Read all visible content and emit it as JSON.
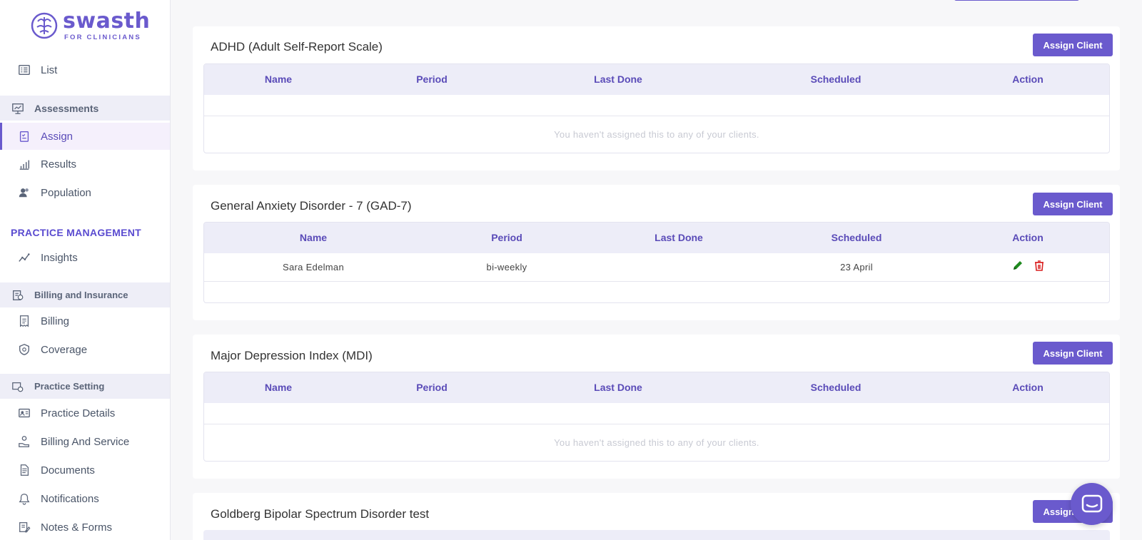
{
  "brand": {
    "name": "swasth",
    "tagline": "FOR CLINICIANS"
  },
  "sidebar": {
    "list": "List",
    "assessments": "Assessments",
    "assign": "Assign",
    "results": "Results",
    "population": "Population",
    "practice_management": "PRACTICE MANAGEMENT",
    "insights": "Insights",
    "billing_insurance": "Billing and Insurance",
    "billing": "Billing",
    "coverage": "Coverage",
    "practice_setting": "Practice Setting",
    "practice_details": "Practice Details",
    "billing_service": "Billing And Service",
    "documents": "Documents",
    "notifications": "Notifications",
    "notes_forms": "Notes & Forms"
  },
  "assign_label": "Assign Client",
  "empty_text": "You haven't assigned this to any of your clients.",
  "columns": [
    "Name",
    "Period",
    "Last Done",
    "Scheduled",
    "Action"
  ],
  "cards": [
    {
      "title": "ADHD (Adult Self-Report Scale)"
    },
    {
      "title": "General Anxiety Disorder - 7 (GAD-7)",
      "row": {
        "name": "Sara Edelman",
        "period": "bi-weekly",
        "last_done": "",
        "scheduled": "23 April"
      }
    },
    {
      "title": "Major Depression Index (MDI)"
    },
    {
      "title": "Goldberg Bipolar Spectrum Disorder test"
    }
  ],
  "colors": {
    "accent": "#6a5acd",
    "header_bg": "#ededf8",
    "edit": "#1e8a1e",
    "delete": "#d92020"
  }
}
